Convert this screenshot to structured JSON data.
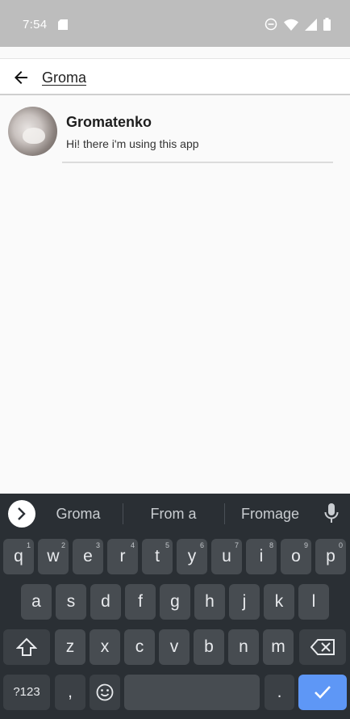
{
  "status_bar": {
    "time": "7:54"
  },
  "search": {
    "query": "Groma"
  },
  "results": [
    {
      "name": "Gromatenko",
      "status": "Hi! there i'm using this app"
    }
  ],
  "keyboard": {
    "suggestions": [
      "Groma",
      "From a",
      "Fromage"
    ],
    "row1": [
      {
        "k": "q",
        "h": "1"
      },
      {
        "k": "w",
        "h": "2"
      },
      {
        "k": "e",
        "h": "3"
      },
      {
        "k": "r",
        "h": "4"
      },
      {
        "k": "t",
        "h": "5"
      },
      {
        "k": "y",
        "h": "6"
      },
      {
        "k": "u",
        "h": "7"
      },
      {
        "k": "i",
        "h": "8"
      },
      {
        "k": "o",
        "h": "9"
      },
      {
        "k": "p",
        "h": "0"
      }
    ],
    "row2": [
      "a",
      "s",
      "d",
      "f",
      "g",
      "h",
      "j",
      "k",
      "l"
    ],
    "row3": [
      "z",
      "x",
      "c",
      "v",
      "b",
      "n",
      "m"
    ],
    "symbols_label": "?123",
    "comma": ",",
    "period": ".",
    "accent_color": "#5e97f6"
  }
}
